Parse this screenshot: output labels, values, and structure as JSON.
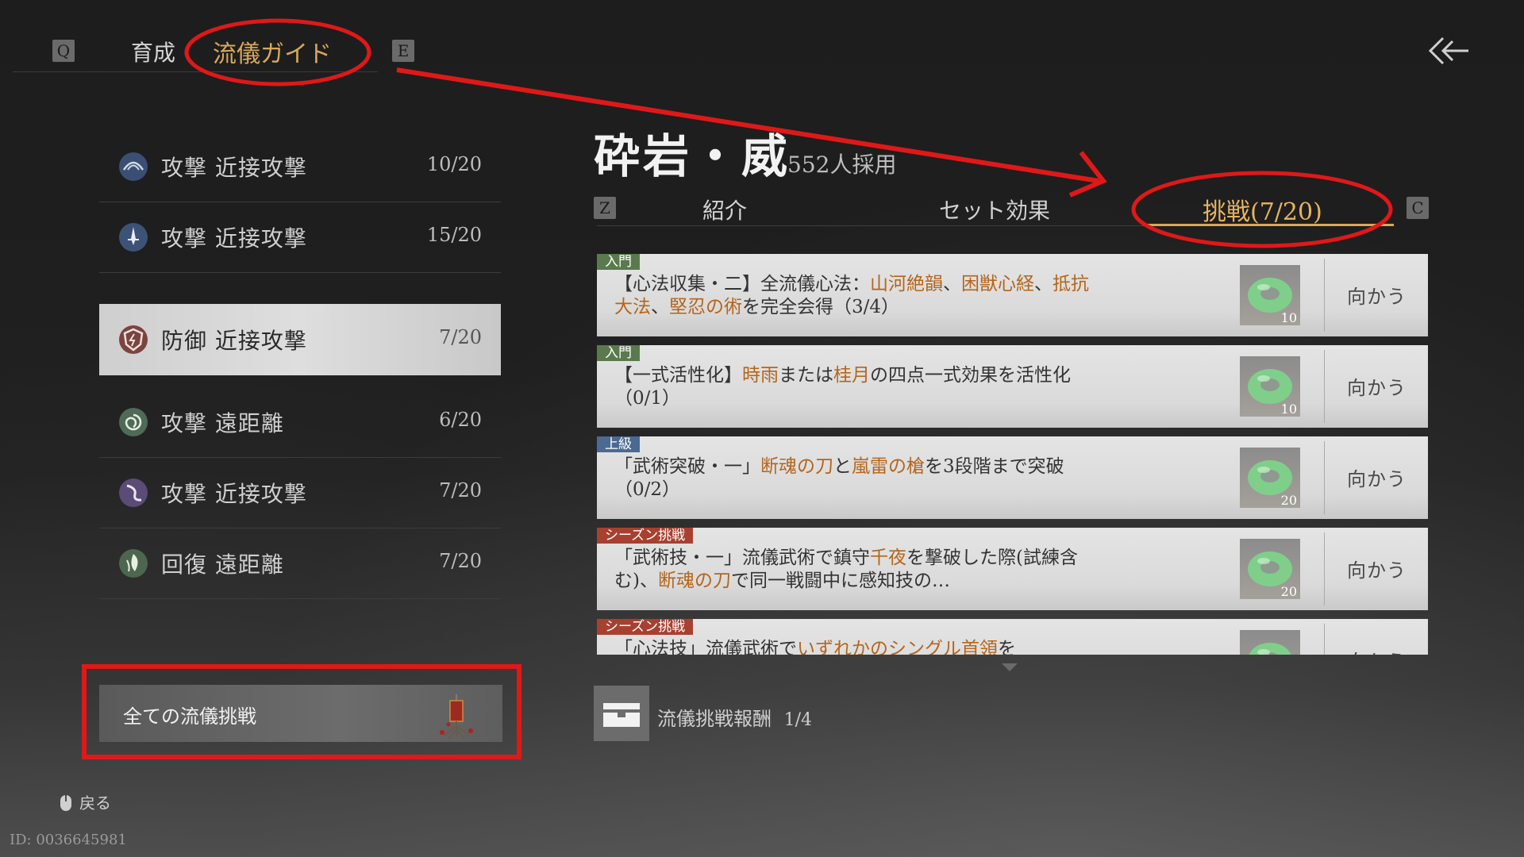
{
  "top_tabs": {
    "q_key": "Q",
    "e_key": "E",
    "tab_grow": "育成",
    "tab_guide": "流儀ガイド"
  },
  "left_list": [
    {
      "label": "攻撃 近接攻撃",
      "count": "10/20",
      "icon": "wave-rune-icon"
    },
    {
      "label": "攻撃 近接攻撃",
      "count": "15/20",
      "icon": "dagger-rune-icon"
    },
    {
      "label": "防御 近接攻撃",
      "count": "7/20",
      "icon": "shield-rune-icon",
      "selected": true
    },
    {
      "label": "攻撃 遠距離",
      "count": "6/20",
      "icon": "spiral-rune-icon"
    },
    {
      "label": "攻撃 近接攻撃",
      "count": "7/20",
      "icon": "swirl-rune-icon"
    },
    {
      "label": "回復 遠距離",
      "count": "7/20",
      "icon": "leaf-rune-icon"
    }
  ],
  "all_challenges_label": "全ての流儀挑戦",
  "main": {
    "title": "砕岩・威",
    "adoption": "552人採用",
    "z_key": "Z",
    "c_key": "C",
    "tabs": [
      "紹介",
      "セット効果",
      "挑戦(7/20)"
    ],
    "active_tab_index": 2
  },
  "challenges": [
    {
      "tag": "入門",
      "tag_color": "green",
      "parts": [
        {
          "t": "【心法収集・二】全流儀心法："
        },
        {
          "t": "山河絶韻",
          "h": true
        },
        {
          "t": "、"
        },
        {
          "t": "困獣心経",
          "h": true
        },
        {
          "t": "、"
        },
        {
          "t": "抵抗大法",
          "h": true
        },
        {
          "t": "、"
        },
        {
          "t": "堅忍の術",
          "h": true
        },
        {
          "t": "を完全会得（3/4）"
        }
      ],
      "reward_amount": "10",
      "goto": "向かう"
    },
    {
      "tag": "入門",
      "tag_color": "green",
      "parts": [
        {
          "t": "【一式活性化】"
        },
        {
          "t": "時雨",
          "h": true
        },
        {
          "t": "または"
        },
        {
          "t": "桂月",
          "h": true
        },
        {
          "t": "の四点一式効果を活性化（0/1）"
        }
      ],
      "reward_amount": "10",
      "goto": "向かう"
    },
    {
      "tag": "上級",
      "tag_color": "blue",
      "parts": [
        {
          "t": "「武術突破・一」"
        },
        {
          "t": "断魂の刀",
          "h": true
        },
        {
          "t": "と"
        },
        {
          "t": "嵐雷の槍",
          "h": true
        },
        {
          "t": "を3段階まで突破（0/2）"
        }
      ],
      "reward_amount": "20",
      "goto": "向かう"
    },
    {
      "tag": "シーズン挑戦",
      "tag_color": "red",
      "parts": [
        {
          "t": "「武術技・一」流儀武術で鎮守"
        },
        {
          "t": "千夜",
          "h": true
        },
        {
          "t": "を撃破した際(試練含む)、"
        },
        {
          "t": "断魂の刀",
          "h": true
        },
        {
          "t": "で同一戦闘中に感知技の…"
        }
      ],
      "reward_amount": "20",
      "goto": "向かう"
    },
    {
      "tag": "シーズン挑戦",
      "tag_color": "red",
      "parts": [
        {
          "t": "「心法技」流儀武術で"
        },
        {
          "t": "いずれかのシングル首領",
          "h": true
        },
        {
          "t": "を"
        }
      ],
      "reward_amount": "",
      "goto": "向かう"
    }
  ],
  "reward_bar": {
    "label": "流儀挑戦報酬",
    "progress": "1/4"
  },
  "back_hint": "戻る",
  "user_id": "ID: 0036645981",
  "colors": {
    "accent": "#d9a85c",
    "highlight": "#b4651c",
    "annotation_red": "#e01818"
  }
}
